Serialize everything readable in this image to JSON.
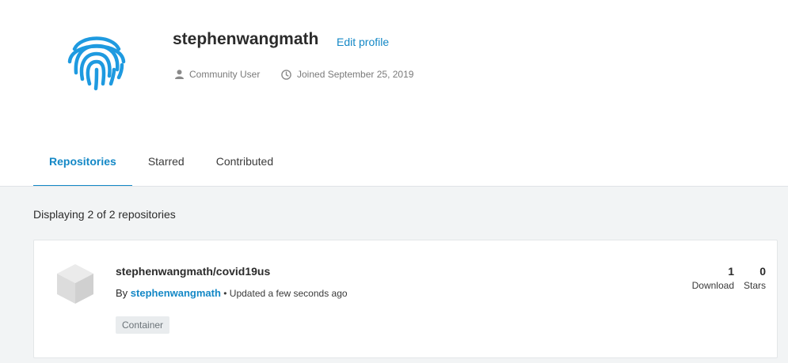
{
  "profile": {
    "username": "stephenwangmath",
    "edit_label": "Edit profile",
    "role": "Community User",
    "joined": "Joined September 25, 2019",
    "avatar_icon": "fingerprint-icon",
    "accent_color": "#1488c6"
  },
  "tabs": [
    {
      "label": "Repositories",
      "active": true
    },
    {
      "label": "Starred",
      "active": false
    },
    {
      "label": "Contributed",
      "active": false
    }
  ],
  "listing": {
    "count_text": "Displaying 2 of 2 repositories"
  },
  "repos": [
    {
      "name": "stephenwangmath/covid19us",
      "by_label": "By",
      "owner": "stephenwangmath",
      "updated": " • Updated a few seconds ago",
      "badge": "Container",
      "downloads": "1",
      "downloads_label": "Download",
      "stars": "0",
      "stars_label": "Stars",
      "icon": "cube-icon"
    }
  ]
}
